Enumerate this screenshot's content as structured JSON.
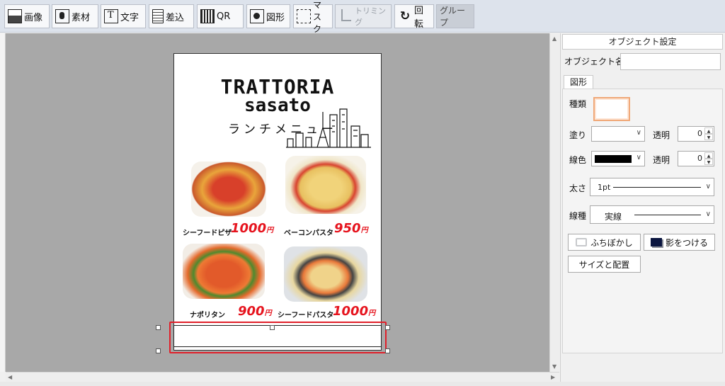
{
  "toolbar": {
    "buttons": [
      {
        "label": "画像",
        "icon": "image-icon"
      },
      {
        "label": "素材",
        "icon": "material-icon"
      },
      {
        "label": "文字",
        "icon": "text-icon"
      },
      {
        "label": "差込",
        "icon": "merge-icon"
      },
      {
        "label": "QR",
        "icon": "qr-icon"
      },
      {
        "label": "図形",
        "icon": "shape-icon"
      },
      {
        "label": "マスク",
        "icon": "mask-icon"
      },
      {
        "label": "トリミング",
        "icon": "crop-icon",
        "disabled": true
      },
      {
        "label": "回転",
        "icon": "rotate-icon"
      },
      {
        "label": "グループ"
      }
    ]
  },
  "flyer": {
    "title_line1": "TRATTORIA",
    "title_line2": "sasato",
    "subtitle": "ランチメニュー",
    "menu": [
      {
        "name": "シーフードピザ",
        "price": "1000",
        "unit": "円"
      },
      {
        "name": "ベーコンパスタ",
        "price": "950",
        "unit": "円"
      },
      {
        "name": "ナポリタン",
        "price": "900",
        "unit": "円"
      },
      {
        "name": "シーフードパスタ",
        "price": "1000",
        "unit": "円"
      }
    ]
  },
  "panel": {
    "header": "オブジェクト設定",
    "object_name_label": "オブジェクト名",
    "object_name_value": "",
    "tab_shape": "図形",
    "type_label": "種類",
    "fill_label": "塗り",
    "fill_opacity_label": "透明",
    "fill_opacity_value": "0",
    "line_color_label": "線色",
    "line_color": "#000000",
    "line_opacity_label": "透明",
    "line_opacity_value": "0",
    "thickness_label": "太さ",
    "thickness_value": "1pt",
    "line_type_label": "線種",
    "line_type_value": "実線",
    "blur_button": "ふちぼかし",
    "shadow_button": "影をつける",
    "size_button": "サイズと配置"
  },
  "colors": {
    "highlight": "#e0202a",
    "price": "#e6141e",
    "swatch_border": "#f0a878"
  }
}
